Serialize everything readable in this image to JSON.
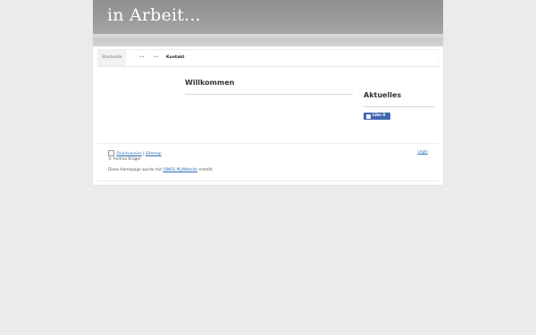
{
  "header": {
    "site_title": "in Arbeit..."
  },
  "nav": {
    "items": [
      {
        "label": "Startseite"
      },
      {
        "label": "••"
      },
      {
        "label": "••"
      },
      {
        "label": "Kontakt"
      }
    ]
  },
  "main": {
    "title": "Willkommen"
  },
  "sidebar": {
    "title": "Aktuelles",
    "like_label": "Like 0"
  },
  "footer": {
    "print_link": "Druckversion",
    "separator": "|",
    "sitemap_link": "Sitemap",
    "copyright": "© Andrea Krüger",
    "built_prefix": "Diese Homepage wurde mit",
    "built_link": "IONOS MyWebsite",
    "built_suffix": "erstellt.",
    "login_link": "Login"
  },
  "colors": {
    "background": "#ebebeb",
    "header": "#9b9b9b",
    "link": "#2a6fb5",
    "facebook": "#4267b2"
  }
}
